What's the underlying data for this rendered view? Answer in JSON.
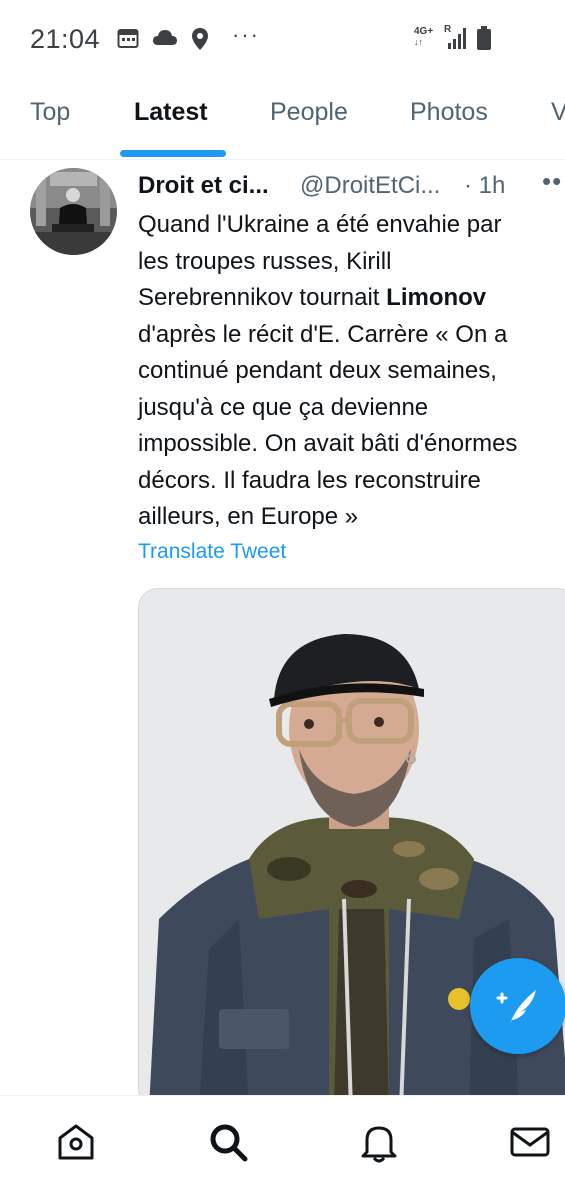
{
  "status_bar": {
    "time": "21:04",
    "network_type": "4G+",
    "roaming": "R",
    "icons": [
      "calendar-icon",
      "cloud-icon",
      "location-pin-icon",
      "more-notifications-icon",
      "signal-icon",
      "battery-icon"
    ]
  },
  "tabs": [
    {
      "label": "Top",
      "active": false
    },
    {
      "label": "Latest",
      "active": true
    },
    {
      "label": "People",
      "active": false
    },
    {
      "label": "Photos",
      "active": false
    },
    {
      "label": "V",
      "active": false
    }
  ],
  "tweet": {
    "author_name": "Droit et ci...",
    "handle": "@DroitEtCi...",
    "time": "· 1h",
    "text_lines": [
      {
        "text": "Quand l'Ukraine a été envahie par"
      },
      {
        "text": "les troupes russes, Kirill"
      },
      {
        "pre": "Serebrennikov tournait ",
        "bold": "Limonov"
      },
      {
        "text": "d'après le récit d'E. Carrère « On a"
      },
      {
        "text": "continué pendant deux semaines,"
      },
      {
        "text": "jusqu'à ce que ça devienne"
      },
      {
        "text": "impossible. On avait bâti d'énormes"
      },
      {
        "text": "décors. Il faudra les reconstruire"
      },
      {
        "text": "ailleurs, en Europe »"
      }
    ],
    "translate_label": "Translate Tweet"
  },
  "bottom_nav": {
    "items": [
      "home-icon",
      "search-icon",
      "notifications-icon",
      "messages-icon"
    ]
  },
  "colors": {
    "accent": "#1d9bf0",
    "text_primary": "#0f1419",
    "text_secondary": "#536471"
  }
}
